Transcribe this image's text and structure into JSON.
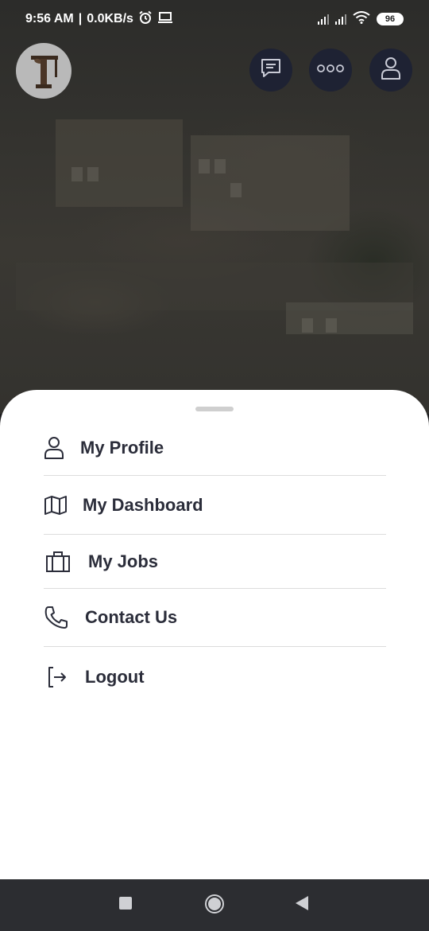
{
  "status_bar": {
    "time": "9:56 AM",
    "network_speed": "0.0KB/s",
    "battery_level": "96"
  },
  "header": {
    "icons": [
      "logo-icon",
      "chat-icon",
      "more-icon",
      "user-icon"
    ]
  },
  "menu": {
    "items": [
      {
        "label": "My Profile",
        "icon": "user-icon"
      },
      {
        "label": "My Dashboard",
        "icon": "map-icon"
      },
      {
        "label": "My Jobs",
        "icon": "briefcase-icon"
      },
      {
        "label": "Contact Us",
        "icon": "phone-icon"
      },
      {
        "label": "Logout",
        "icon": "logout-icon"
      }
    ]
  },
  "nav_bar": {
    "icons": [
      "recents-icon",
      "home-icon",
      "back-icon"
    ]
  },
  "colors": {
    "sheet_background": "#ffffff",
    "menu_text": "#2b2d3a",
    "header_button": "#1e2233",
    "nav_bar": "#2c2d31"
  }
}
